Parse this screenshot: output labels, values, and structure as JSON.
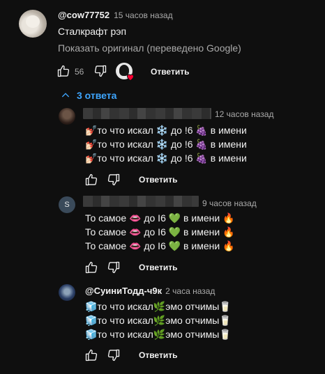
{
  "top_comment": {
    "handle": "@cow77752",
    "time": "15 часов назад",
    "text": "Сталкрафт рэп",
    "translate_link": "Показать оригинал (переведено Google)",
    "likes": "56",
    "reply_label": "Ответить"
  },
  "replies_toggle": {
    "label": "3 ответа",
    "icon": "chevron-up-icon"
  },
  "replies": [
    {
      "time": "12 часов назад",
      "lines": [
        "💅🏻то что искал ❄️ до !6 🍇 в имени",
        "💅🏻то что искал ❄️ до !6 🍇 в имени",
        "💅🏻то что искал ❄️ до !6 🍇 в имени"
      ],
      "reply_label": "Ответить"
    },
    {
      "avatar_letter": "S",
      "time": "9 часов назад",
      "lines": [
        "То самое 👄 до I6 💚 в имени 🔥",
        "То самое 👄 до I6 💚 в имени 🔥",
        "То самое 👄 до I6 💚 в имени 🔥"
      ],
      "reply_label": "Ответить"
    },
    {
      "handle": "@СуиниТодд-ч9к",
      "time": "2 часа назад",
      "lines": [
        "🧊то что искал🌿эмо отчимы🥛",
        "🧊то что искал🌿эмо отчимы🥛",
        "🧊то что искал🌿эмо отчимы🥛"
      ],
      "reply_label": "Ответить"
    }
  ],
  "colors": {
    "background": "#0f0f0f",
    "link": "#3ea6ff",
    "muted": "#aaaaaa",
    "heart": "#ff0033"
  }
}
